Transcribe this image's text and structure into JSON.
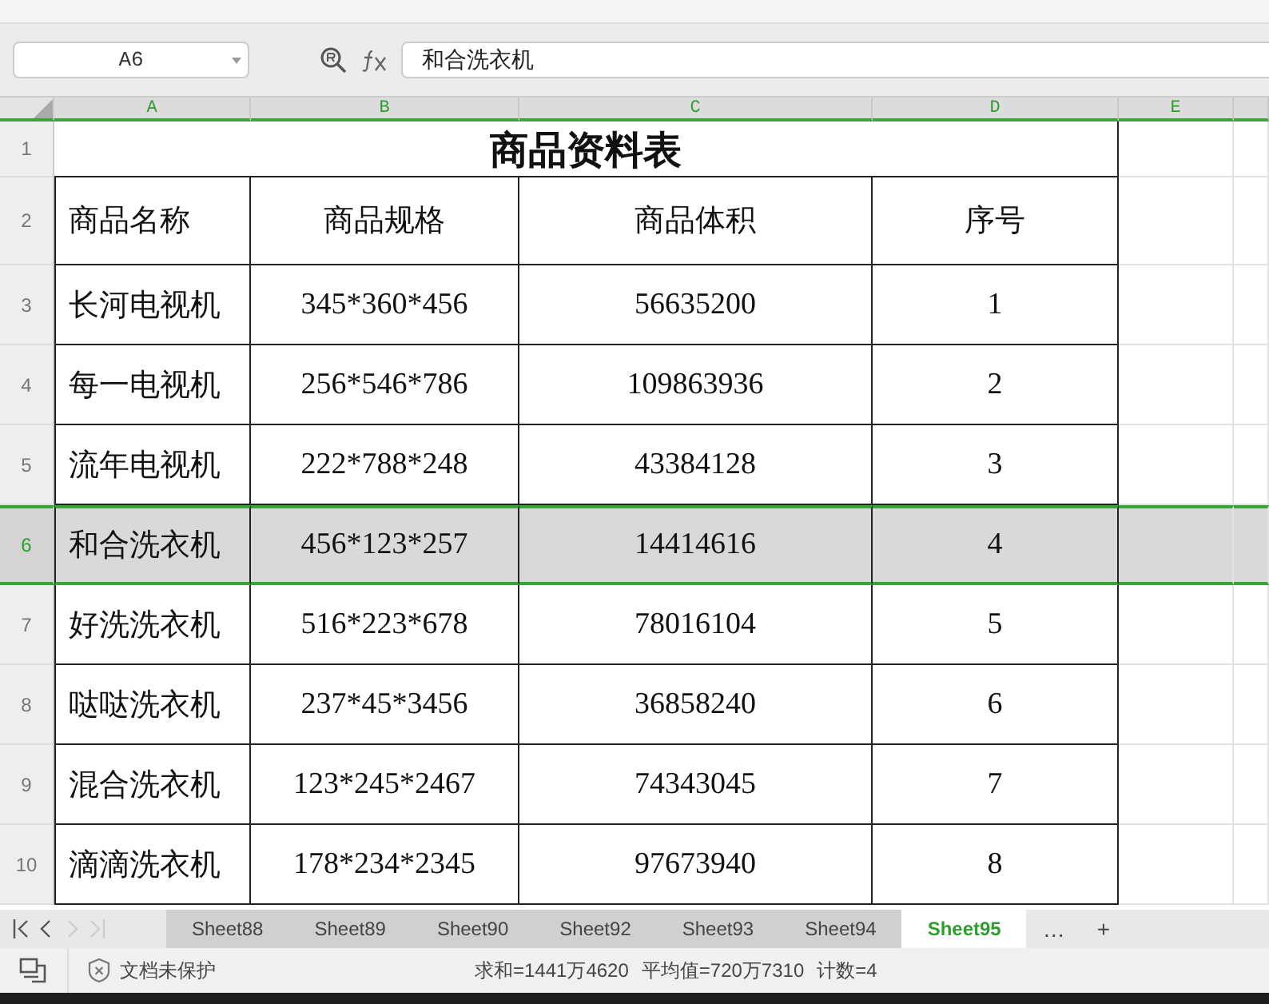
{
  "name_box": {
    "value": "A6"
  },
  "formula_bar": {
    "value": "和合洗衣机"
  },
  "columns": [
    "A",
    "B",
    "C",
    "D",
    "E"
  ],
  "title": "商品资料表",
  "rows": [
    {
      "number": "1",
      "kind": "title",
      "selected": false
    },
    {
      "number": "2",
      "kind": "header",
      "selected": false,
      "cells": [
        "商品名称",
        "商品规格",
        "商品体积",
        "序号"
      ]
    },
    {
      "number": "3",
      "kind": "data",
      "selected": false,
      "cells": [
        "长河电视机",
        "345*360*456",
        "56635200",
        "1"
      ]
    },
    {
      "number": "4",
      "kind": "data",
      "selected": false,
      "cells": [
        "每一电视机",
        "256*546*786",
        "109863936",
        "2"
      ]
    },
    {
      "number": "5",
      "kind": "data",
      "selected": false,
      "cells": [
        "流年电视机",
        "222*788*248",
        "43384128",
        "3"
      ]
    },
    {
      "number": "6",
      "kind": "data",
      "selected": true,
      "cells": [
        "和合洗衣机",
        "456*123*257",
        "14414616",
        "4"
      ]
    },
    {
      "number": "7",
      "kind": "data",
      "selected": false,
      "cells": [
        "好洗洗衣机",
        "516*223*678",
        "78016104",
        "5"
      ]
    },
    {
      "number": "8",
      "kind": "data",
      "selected": false,
      "cells": [
        "哒哒洗衣机",
        "237*45*3456",
        "36858240",
        "6"
      ]
    },
    {
      "number": "9",
      "kind": "data",
      "selected": false,
      "cells": [
        "混合洗衣机",
        "123*245*2467",
        "74343045",
        "7"
      ]
    },
    {
      "number": "10",
      "kind": "data",
      "selected": false,
      "cells": [
        "滴滴洗衣机",
        "178*234*2345",
        "97673940",
        "8"
      ]
    }
  ],
  "sheet_tabs": [
    {
      "label": "Sheet88",
      "selected": false
    },
    {
      "label": "Sheet89",
      "selected": false
    },
    {
      "label": "Sheet90",
      "selected": false
    },
    {
      "label": "Sheet92",
      "selected": false
    },
    {
      "label": "Sheet93",
      "selected": false
    },
    {
      "label": "Sheet94",
      "selected": false
    },
    {
      "label": "Sheet95",
      "selected": true
    }
  ],
  "more_tabs": "…",
  "add_sheet": "+",
  "status_bar": {
    "protection": "文档未保护",
    "sum": "求和=1441万4620",
    "average": "平均值=720万7310",
    "count": "计数=4"
  }
}
